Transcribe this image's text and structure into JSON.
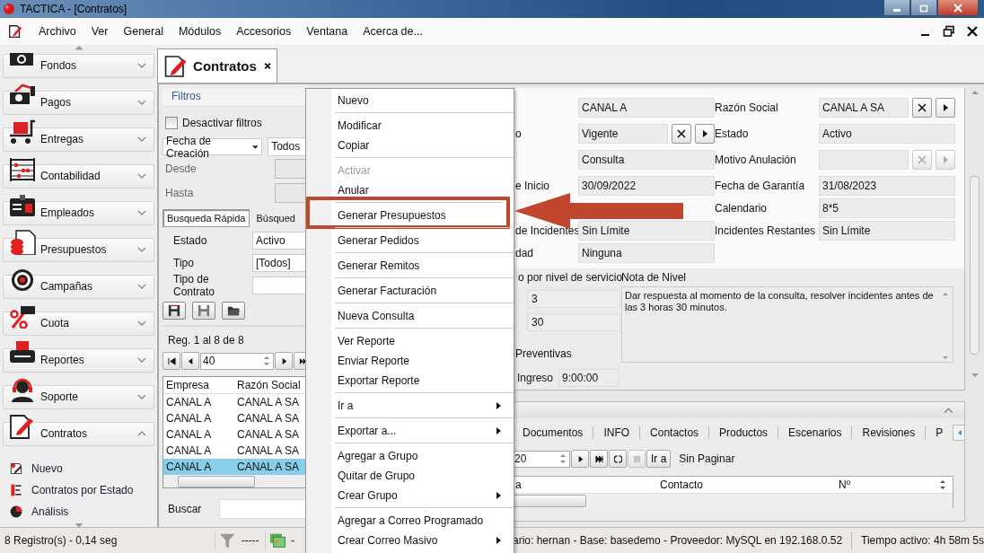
{
  "window": {
    "title": "TACTICA - [Contratos]"
  },
  "menu_bar": [
    "Archivo",
    "Ver",
    "General",
    "Módulos",
    "Accesorios",
    "Ventana",
    "Acerca de..."
  ],
  "sidebar": {
    "groups": [
      {
        "label": "Fondos",
        "expanded": false
      },
      {
        "label": "Pagos",
        "expanded": false
      },
      {
        "label": "Entregas",
        "expanded": false
      },
      {
        "label": "Contabilidad",
        "expanded": false
      },
      {
        "label": "Empleados",
        "expanded": false
      },
      {
        "label": "Presupuestos",
        "expanded": false
      },
      {
        "label": "Campañas",
        "expanded": false
      },
      {
        "label": "Cuota",
        "expanded": false
      },
      {
        "label": "Reportes",
        "expanded": false
      },
      {
        "label": "Soporte",
        "expanded": false
      },
      {
        "label": "Contratos",
        "expanded": true,
        "items": [
          "Nuevo",
          "Contratos por Estado",
          "Análisis"
        ]
      }
    ]
  },
  "document_tab": {
    "label": "Contratos"
  },
  "filters": {
    "title": "Filtros",
    "disable_filters": {
      "label": "Desactivar filtros",
      "checked": false
    },
    "date_field": "Fecha de Creación",
    "date_range": "Todos",
    "from_label": "Desde",
    "to_label": "Hasta",
    "search_tabs": [
      {
        "label": "Busqueda Rápida",
        "selected": true
      },
      {
        "label": "Búsqued",
        "selected": false
      }
    ],
    "fields": [
      {
        "label": "Estado",
        "value": "Activo"
      },
      {
        "label": "Tipo",
        "value": "[Todos]"
      },
      {
        "label": "Tipo de Contrato"
      }
    ]
  },
  "records": {
    "summary": "Reg. 1 al 8 de 8",
    "page_size": "40",
    "columns": [
      "Empresa",
      "Razón Social"
    ],
    "rows": [
      {
        "cells": [
          "CANAL A",
          "CANAL A SA"
        ],
        "selected": false
      },
      {
        "cells": [
          "CANAL A",
          "CANAL A SA"
        ],
        "selected": false
      },
      {
        "cells": [
          "CANAL A",
          "CANAL A SA"
        ],
        "selected": false
      },
      {
        "cells": [
          "CANAL A",
          "CANAL A SA"
        ],
        "selected": false
      },
      {
        "cells": [
          "CANAL A",
          "CANAL A SA"
        ],
        "selected": true
      }
    ],
    "search_label": "Buscar"
  },
  "form": {
    "rows": [
      {
        "left": {
          "value": "CANAL A"
        },
        "right": {
          "label": "Razón Social",
          "value": "CANAL A SA",
          "actions": {
            "disabled": false
          }
        }
      },
      {
        "left": {
          "label": "o",
          "value": "Vigente",
          "actions": {
            "disabled": false
          }
        },
        "right": {
          "label": "Estado",
          "value": "Activo"
        }
      },
      {
        "left": {
          "value": "Consulta"
        },
        "right": {
          "label": "Motivo Anulación",
          "actions": {
            "disabled": true
          }
        }
      },
      {
        "left": {
          "label": "e Inicio",
          "value": "30/09/2022"
        },
        "right": {
          "label": "Fecha de Garantía",
          "value": "31/08/2023"
        }
      },
      {
        "right": {
          "label": "Calendario",
          "value": "8*5"
        }
      },
      {
        "left": {
          "label": "de Incidentes",
          "value": "Sin Límite"
        },
        "right": {
          "label": "Incidentes Restantes",
          "value": "Sin Límite"
        }
      },
      {
        "left": {
          "label": "dad",
          "value": "Ninguna"
        }
      }
    ],
    "service": {
      "title": "o por nivel de servicio",
      "values": [
        "3",
        "30"
      ],
      "note_title": "Nota de Nivel",
      "note": "Dar respuesta al momento de la consulta, resolver incidentes antes de las 3 horas 30 minutos."
    },
    "preventive_label": "Preventivas",
    "ingreso": {
      "label": "Ingreso",
      "value": "9:00:00"
    }
  },
  "detail": {
    "tabs": [
      "Documentos",
      "INFO",
      "Contactos",
      "Productos",
      "Escenarios",
      "Revisiones",
      "P"
    ],
    "page_size": "20",
    "go_label": "Ir a",
    "paging": "Sin Paginar",
    "columns": [
      "a",
      "Contacto",
      "Nº"
    ]
  },
  "context_menu": [
    {
      "label": "Nuevo",
      "disabled": false,
      "submenu": false,
      "separator_before": false,
      "callout": false
    },
    {
      "label": "Modificar",
      "disabled": false,
      "submenu": false,
      "separator_before": true,
      "callout": false
    },
    {
      "label": "Copiar",
      "disabled": false,
      "submenu": false,
      "separator_before": false,
      "callout": false
    },
    {
      "label": "Activar",
      "disabled": true,
      "submenu": false,
      "separator_before": true,
      "callout": false
    },
    {
      "label": "Anular",
      "disabled": false,
      "submenu": false,
      "separator_before": false,
      "callout": false
    },
    {
      "label": "Generar Presupuestos",
      "disabled": false,
      "submenu": false,
      "separator_before": true,
      "callout": true
    },
    {
      "label": "Generar Pedidos",
      "disabled": false,
      "submenu": false,
      "separator_before": true,
      "callout": false
    },
    {
      "label": "Generar Remitos",
      "disabled": false,
      "submenu": false,
      "separator_before": true,
      "callout": false
    },
    {
      "label": "Generar Facturación",
      "disabled": false,
      "submenu": false,
      "separator_before": true,
      "callout": false
    },
    {
      "label": "Nueva Consulta",
      "disabled": false,
      "submenu": false,
      "separator_before": true,
      "callout": false
    },
    {
      "label": "Ver Reporte",
      "disabled": false,
      "submenu": false,
      "separator_before": true,
      "callout": false
    },
    {
      "label": "Enviar Reporte",
      "disabled": false,
      "submenu": false,
      "separator_before": false,
      "callout": false
    },
    {
      "label": "Exportar Reporte",
      "disabled": false,
      "submenu": false,
      "separator_before": false,
      "callout": false
    },
    {
      "label": "Ir a",
      "disabled": false,
      "submenu": true,
      "separator_before": true,
      "callout": false
    },
    {
      "label": "Exportar a...",
      "disabled": false,
      "submenu": true,
      "separator_before": true,
      "callout": false
    },
    {
      "label": "Agregar a Grupo",
      "disabled": false,
      "submenu": false,
      "separator_before": true,
      "callout": false
    },
    {
      "label": "Quitar de Grupo",
      "disabled": false,
      "submenu": false,
      "separator_before": false,
      "callout": false
    },
    {
      "label": "Crear Grupo",
      "disabled": false,
      "submenu": true,
      "separator_before": false,
      "callout": false
    },
    {
      "label": "Agregar a Correo Programado",
      "disabled": false,
      "submenu": false,
      "separator_before": true,
      "callout": false
    },
    {
      "label": "Crear Correo Masivo",
      "disabled": false,
      "submenu": true,
      "separator_before": false,
      "callout": false
    }
  ],
  "status_bar": {
    "records": "8 Registro(s) - 0,14 seg",
    "filter": "-----",
    "cards": "-",
    "connection": "ario: hernan - Base: basedemo - Proveedor: MySQL en 192.168.0.52",
    "uptime": "Tiempo activo: 4h 58m 5s"
  }
}
